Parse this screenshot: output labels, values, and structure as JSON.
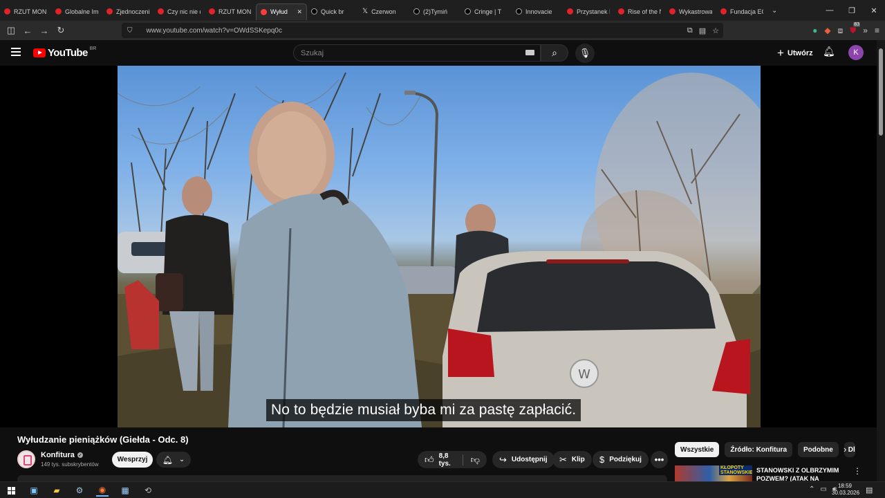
{
  "browser": {
    "tabs": [
      {
        "title": "RZUT MONET",
        "favicon": "youtube",
        "active": false
      },
      {
        "title": "Globalne Imp",
        "favicon": "youtube",
        "active": false
      },
      {
        "title": "Zjednoczeni",
        "favicon": "youtube",
        "active": false
      },
      {
        "title": "Czy nic nie d",
        "favicon": "youtube",
        "active": false
      },
      {
        "title": "RZUT MONET",
        "favicon": "youtube",
        "active": false
      },
      {
        "title": "Wyłud",
        "favicon": "youtube",
        "active": true
      },
      {
        "title": "Quick br",
        "favicon": "tiktok",
        "active": false
      },
      {
        "title": "Czerwon",
        "favicon": "x",
        "active": false
      },
      {
        "title": "(2)Tymiń",
        "favicon": "tiktok",
        "active": false
      },
      {
        "title": "Cringe | T",
        "favicon": "tiktok",
        "active": false
      },
      {
        "title": "Innovacie",
        "favicon": "tiktok",
        "active": false
      },
      {
        "title": "Przystanek Le",
        "favicon": "youtube",
        "active": false
      },
      {
        "title": "Rise of the N",
        "favicon": "youtube",
        "active": false
      },
      {
        "title": "Wykastrowa",
        "favicon": "youtube",
        "active": false
      },
      {
        "title": "Fundacja ECF",
        "favicon": "youtube",
        "active": false
      }
    ],
    "url": "www.youtube.com/watch?v=OWdSSKepq0c",
    "extension_badge": "83"
  },
  "youtube": {
    "logo_text": "YouTube",
    "country_code": "BR",
    "search_placeholder": "Szukaj",
    "create_label": "Utwórz",
    "avatar_letter": "K",
    "avatar_color": "#8e44ad"
  },
  "video": {
    "subtitle": "No to będzie musiał byba mi za pastę zapłacić.",
    "title": "Wyłudzanie pieniążków (Giełda - Odc. 8)",
    "channel_name": "Konfitura",
    "subscribers": "149 tys. subskrybentów",
    "support_label": "Wesprzyj",
    "likes": "8,8 tys.",
    "share_label": "Udostępnij",
    "clip_label": "Klip",
    "thanks_label": "Podziękuj"
  },
  "sidebar": {
    "chips": [
      "Wszystkie",
      "Źródło: Konfitura",
      "Podobne",
      "Dla"
    ],
    "recommendation": {
      "title": "STANOWSKI Z OLBRZYMIM POZWEM? (ATAK NA",
      "thumb_text": "KŁOPOTY STANOWSKIEGO"
    }
  },
  "taskbar": {
    "time": "18:59",
    "date": "30.03.2026"
  }
}
